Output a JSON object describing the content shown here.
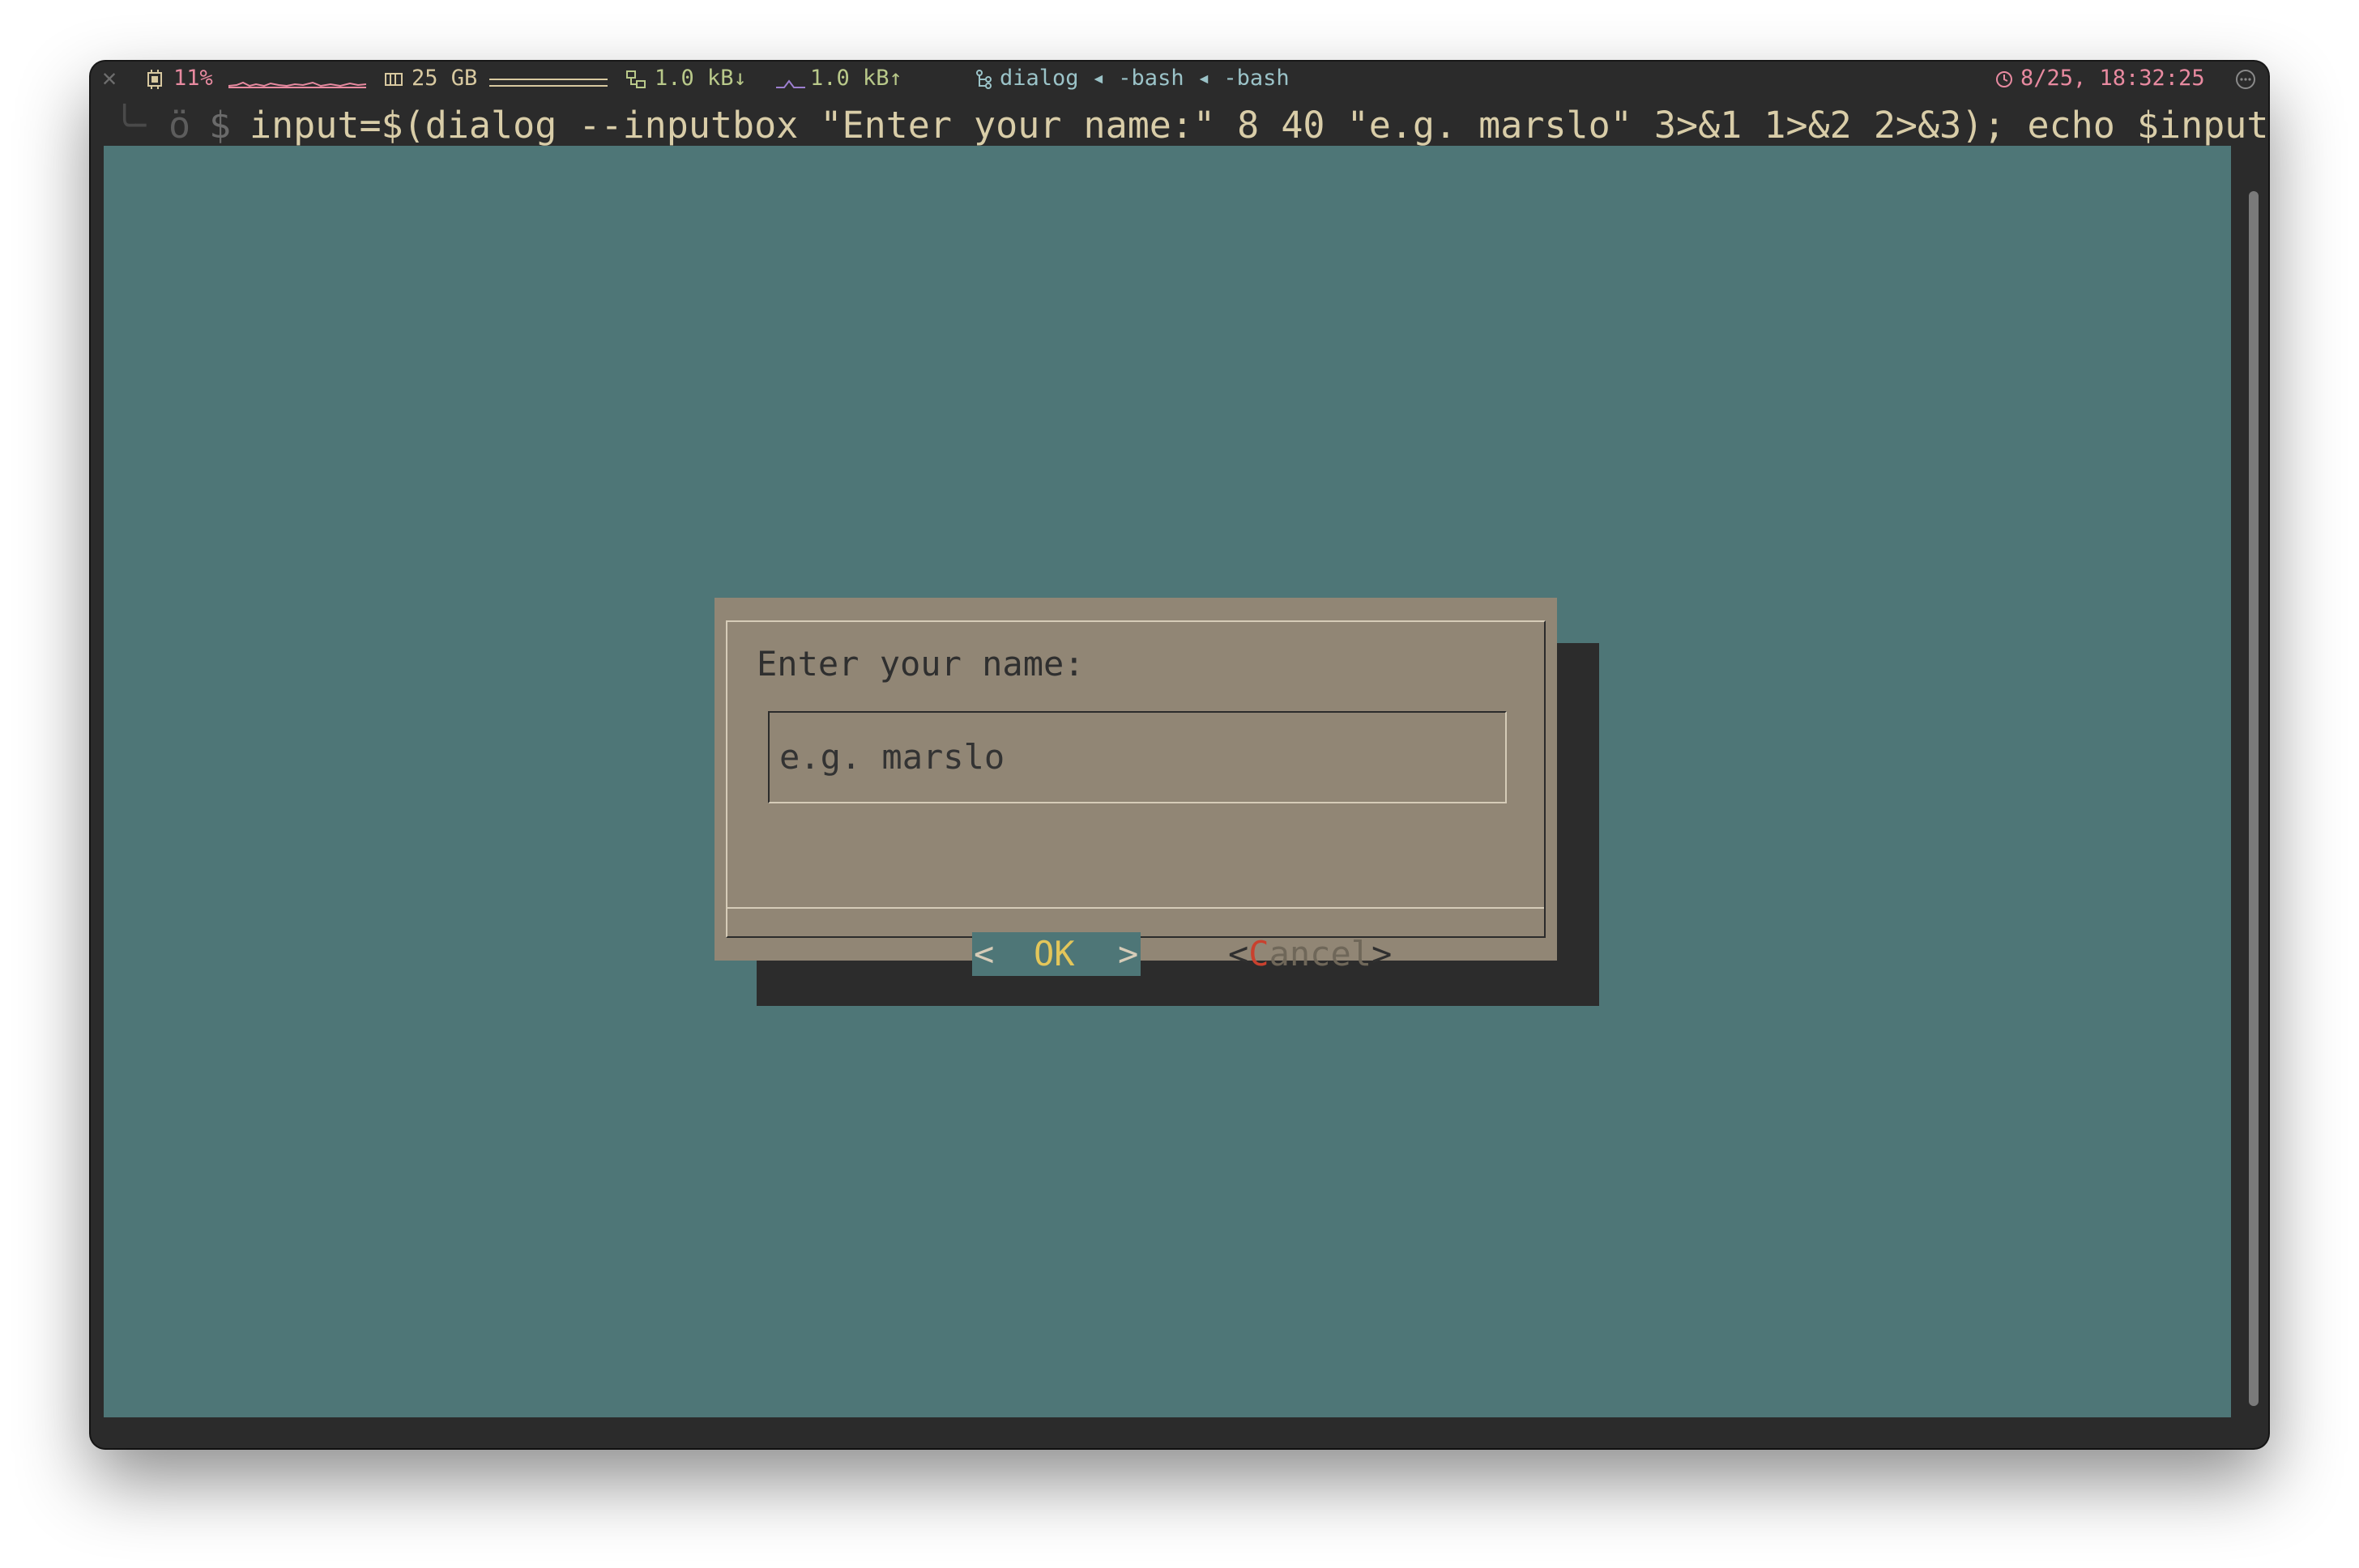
{
  "statusbar": {
    "close_glyph": "✕",
    "cpu_icon": "cpu-icon",
    "cpu_percent": "11%",
    "memory_icon": "memory-icon",
    "memory": "25 GB",
    "network_icon": "network-icon",
    "download": "1.0 kB↓",
    "upload": "1.0 kB↑",
    "process_icon": "process-tree-icon",
    "process_chain": "dialog ◂ -bash ◂ -bash",
    "clock_icon": "clock-icon",
    "datetime": "8/25, 18:32:25",
    "menu_icon": "more-icon"
  },
  "terminal": {
    "prompt_decor": "╰╴",
    "prompt_face": "ö",
    "prompt_symbol": "$",
    "command": "input=$(dialog --inputbox \"Enter your name:\" 8 40 \"e.g. marslo\" 3>&1 1>&2 2>&3); echo $input"
  },
  "dialog": {
    "prompt": "Enter your name:",
    "input_value": "e.g. marslo",
    "ok": {
      "left": "<",
      "label": "OK",
      "right": ">"
    },
    "cancel": {
      "left": "<",
      "hotkey": "C",
      "rest": "ancel",
      "right": ">"
    }
  },
  "colors": {
    "backdrop": "#4e7677",
    "dialog_bg": "#918675",
    "shadow": "#2c2c2c",
    "window": "#2b2b2b",
    "hotkey_red": "#c9412e",
    "ok_yellow": "#e3c65a"
  }
}
